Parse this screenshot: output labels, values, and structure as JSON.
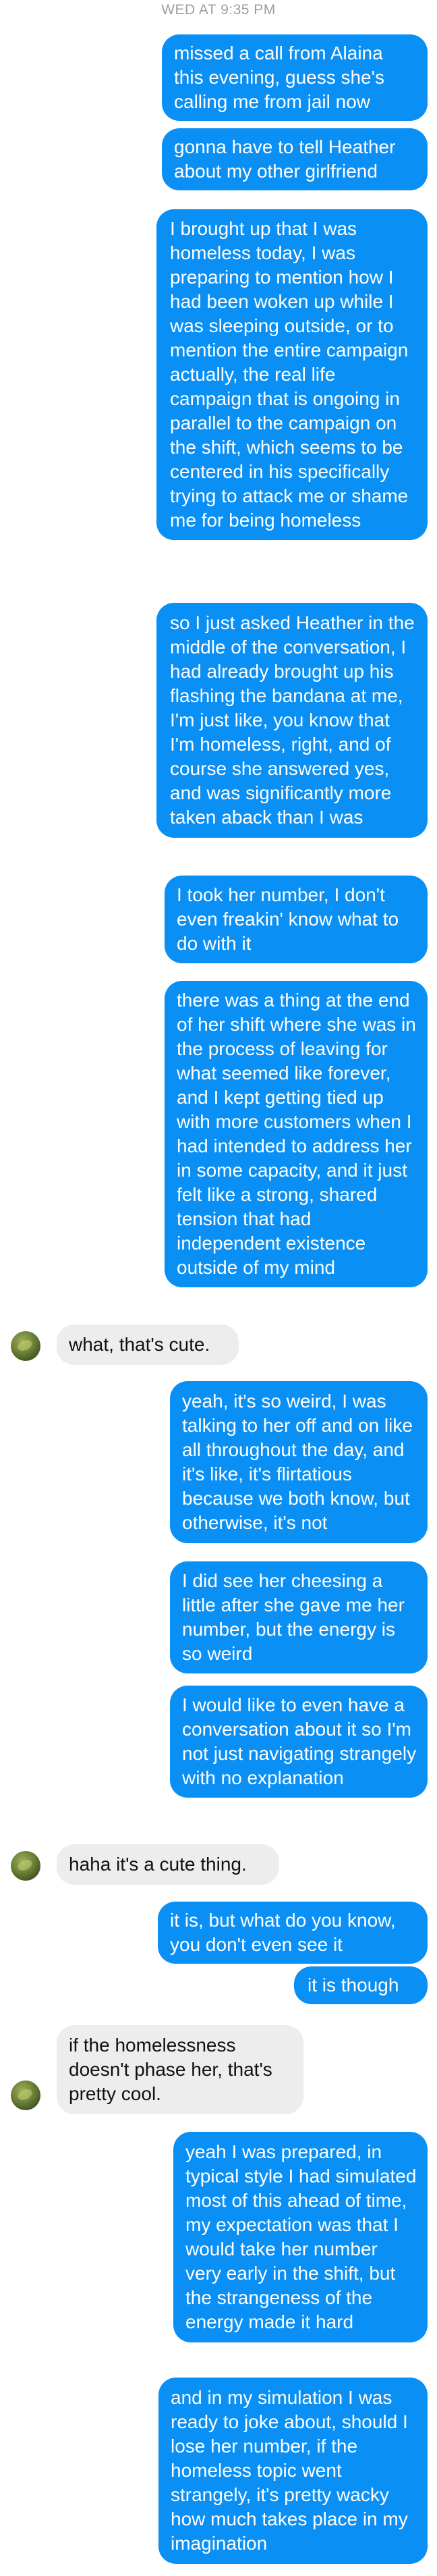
{
  "conversation": {
    "timestamp": "WED AT 9:35 PM",
    "messages": [
      {
        "from": "me",
        "text": "missed a call from Alaina this evening, guess she's calling me from jail now"
      },
      {
        "from": "me",
        "text": "gonna have to tell Heather about my other girlfriend"
      },
      {
        "from": "me",
        "text": "I brought up that I was homeless today, I was preparing to mention how I had been woken up while I was sleeping outside, or to mention the entire campaign actually, the real life campaign that is ongoing in parallel to the campaign on the shift, which seems to be centered in his specifically trying to attack me or shame me for being homeless"
      },
      {
        "from": "me",
        "text": "so I just asked Heather in the middle of the conversation, I had already brought up his flashing the bandana at me, I'm just like, you know that I'm homeless, right, and of course she answered yes, and was significantly more taken aback than I was"
      },
      {
        "from": "me",
        "text": "I took her number, I don't even freakin' know what to do with it"
      },
      {
        "from": "me",
        "text": "there was a thing at the end of her shift where she was in the process of leaving for what seemed like forever, and I kept getting tied up with more customers when I had intended to address her in some capacity, and it just felt like a strong, shared tension that had independent existence outside of my mind"
      },
      {
        "from": "them",
        "text": "what, that's cute."
      },
      {
        "from": "me",
        "text": "yeah, it's so weird, I was talking to her off and on like all throughout the day, and it's like, it's flirtatious because we both know, but otherwise, it's not"
      },
      {
        "from": "me",
        "text": "I did see her cheesing a little after she gave me her number, but the energy is so weird"
      },
      {
        "from": "me",
        "text": "I would like to even have a conversation about it so I'm not just navigating strangely with no explanation"
      },
      {
        "from": "them",
        "text": "haha it's a cute thing."
      },
      {
        "from": "me",
        "text": "it is, but what do you know, you don't even see it"
      },
      {
        "from": "me",
        "text": "it is though"
      },
      {
        "from": "them",
        "text": "if the homelessness doesn't phase her, that's pretty cool."
      },
      {
        "from": "me",
        "text": "yeah I was prepared, in typical style I had simulated most of this ahead of time, my expectation was that I would take her number very early in the shift, but the strangeness of the energy made it hard"
      },
      {
        "from": "me",
        "text": "and in my simulation I was ready to joke about, should I lose her number, if the homeless topic went strangely, it's pretty wacky how much takes place in my imagination"
      }
    ]
  }
}
